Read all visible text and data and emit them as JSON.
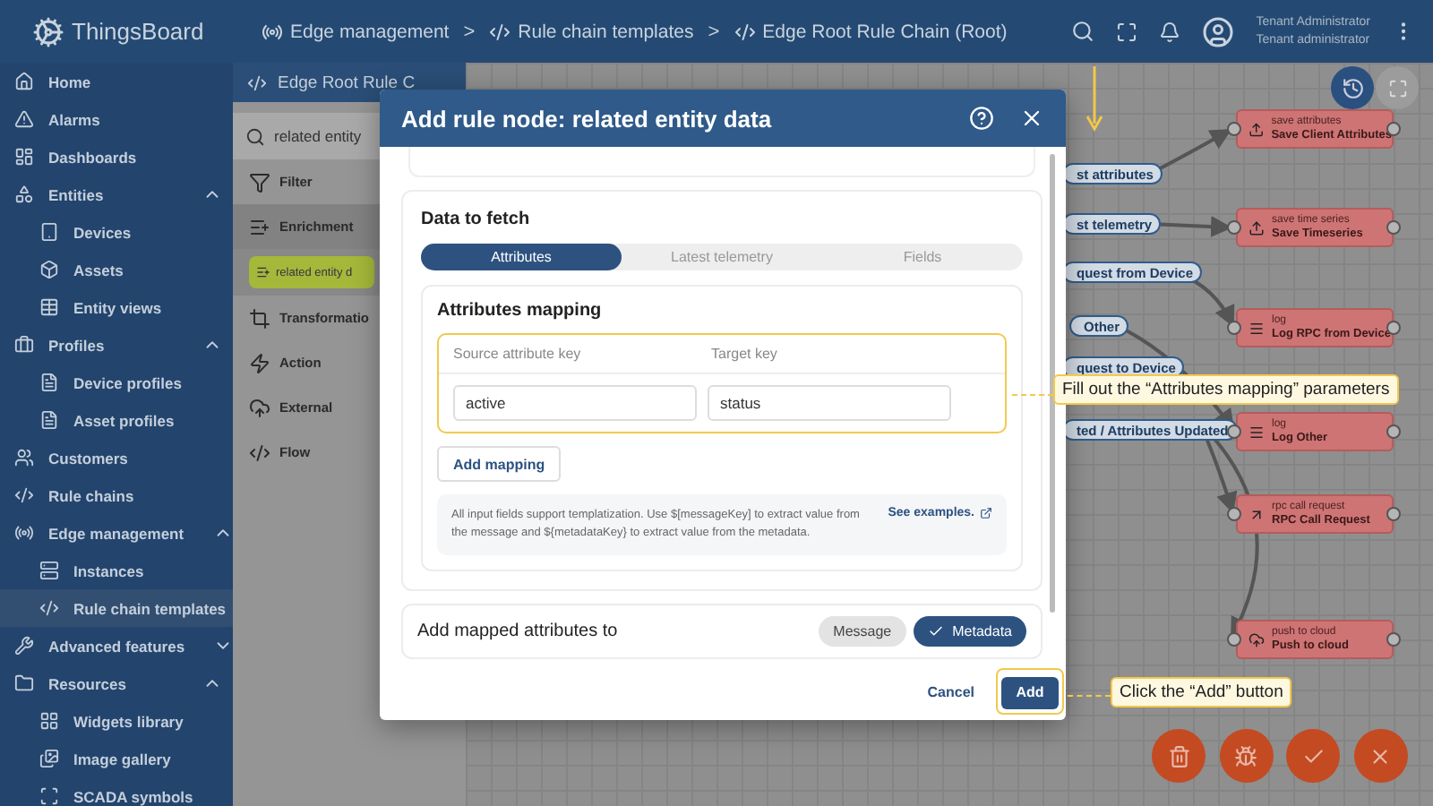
{
  "header": {
    "logo": "ThingsBoard",
    "breadcrumbs": [
      {
        "label": "Edge management",
        "separator": ">"
      },
      {
        "label": "Rule chain templates",
        "separator": ">"
      },
      {
        "label": "Edge Root Rule Chain (Root)"
      }
    ],
    "user": {
      "name": "Tenant Administrator",
      "role": "Tenant administrator"
    }
  },
  "sidebar": {
    "items": [
      {
        "label": "Home",
        "selected": false
      },
      {
        "label": "Alarms",
        "selected": false
      },
      {
        "label": "Dashboards",
        "selected": false
      },
      {
        "label": "Entities",
        "selected": false,
        "expanded": true,
        "children": [
          {
            "label": "Devices",
            "selected": false
          },
          {
            "label": "Assets",
            "selected": false
          },
          {
            "label": "Entity views",
            "selected": false
          }
        ]
      },
      {
        "label": "Profiles",
        "selected": false,
        "expanded": true,
        "children": [
          {
            "label": "Device profiles",
            "selected": false
          },
          {
            "label": "Asset profiles",
            "selected": false
          }
        ]
      },
      {
        "label": "Customers",
        "selected": false
      },
      {
        "label": "Rule chains",
        "selected": false
      },
      {
        "label": "Edge management",
        "selected": false,
        "expanded": true,
        "children": [
          {
            "label": "Instances",
            "selected": false
          },
          {
            "label": "Rule chain templates",
            "selected": true
          }
        ]
      },
      {
        "label": "Advanced features",
        "selected": false,
        "expanded": false
      },
      {
        "label": "Resources",
        "selected": false,
        "expanded": true,
        "children": [
          {
            "label": "Widgets library",
            "selected": false
          },
          {
            "label": "Image gallery",
            "selected": false
          },
          {
            "label": "SCADA symbols",
            "selected": false
          }
        ]
      }
    ]
  },
  "library": {
    "title": "Edge Root Rule C",
    "search": "related entity",
    "categories": [
      {
        "label": "Filter",
        "expanded": false
      },
      {
        "label": "Enrichment",
        "expanded": true,
        "nodes": [
          "related entity d"
        ]
      },
      {
        "label": "Transformatio",
        "expanded": false
      },
      {
        "label": "Action",
        "expanded": false
      },
      {
        "label": "External",
        "expanded": false
      },
      {
        "label": "Flow",
        "expanded": false
      }
    ]
  },
  "canvas": {
    "edge_labels": [
      "st attributes",
      "st telemetry",
      "quest from Device",
      "Other",
      "quest to Device",
      "ted / Attributes Updated"
    ],
    "nodes": [
      {
        "type": "save attributes",
        "name": "Save Client Attributes"
      },
      {
        "type": "save time series",
        "name": "Save Timeseries"
      },
      {
        "type": "log",
        "name": "Log RPC from Device"
      },
      {
        "type": "log",
        "name": "Log Other"
      },
      {
        "type": "rpc call request",
        "name": "RPC Call Request"
      },
      {
        "type": "push to cloud",
        "name": "Push to cloud"
      }
    ]
  },
  "dialog": {
    "title": "Add rule node: related entity data",
    "section": "Data to fetch",
    "tabs": [
      {
        "label": "Attributes",
        "selected": true
      },
      {
        "label": "Latest telemetry",
        "selected": false
      },
      {
        "label": "Fields",
        "selected": false
      }
    ],
    "mapping": {
      "title": "Attributes mapping",
      "columns": [
        "Source attribute key",
        "Target key"
      ],
      "rows": [
        {
          "source": "active",
          "target": "status"
        }
      ],
      "add_button": "Add mapping"
    },
    "info": {
      "text": "All input fields support templatization. Use $[messageKey] to extract value from the message and ${metadataKey} to extract value from the metadata.",
      "link": "See examples."
    },
    "target": {
      "label": "Add mapped attributes to",
      "options": [
        {
          "label": "Message",
          "selected": false
        },
        {
          "label": "Metadata",
          "selected": true
        }
      ]
    },
    "buttons": {
      "cancel": "Cancel",
      "add": "Add"
    }
  },
  "callouts": [
    {
      "text": "Fill out the “Attributes mapping” parameters"
    },
    {
      "text": "Click the “Add” button"
    }
  ]
}
